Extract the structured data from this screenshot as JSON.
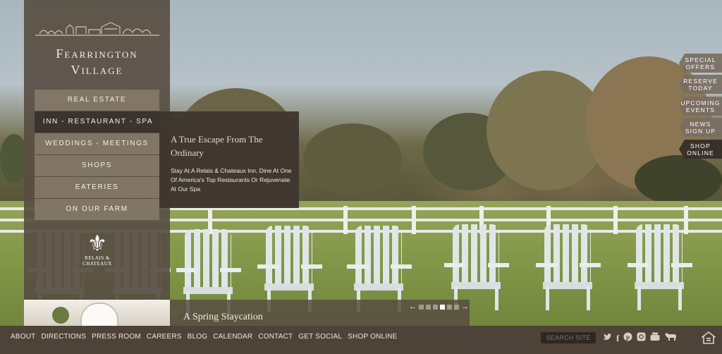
{
  "brand": {
    "title_line1": "Fearrington",
    "title_line2": "Village",
    "logo_icon": "farm-skyline-icon"
  },
  "nav": {
    "items": [
      {
        "label": "REAL ESTATE",
        "active": false
      },
      {
        "label": "INN - RESTAURANT - SPA",
        "active": true
      },
      {
        "label": "WEDDINGS - MEETINGS",
        "active": false
      },
      {
        "label": "SHOPS",
        "active": false
      },
      {
        "label": "EATERIES",
        "active": false
      },
      {
        "label": "ON OUR FARM",
        "active": false
      }
    ],
    "partner_logo_text_1": "RELAIS &",
    "partner_logo_text_2": "CHATEAUX",
    "partner_logo_icon": "fleur-de-lis-icon"
  },
  "flyout": {
    "title": "A True Escape From The Ordinary",
    "body": "Stay At A Relais & Chateaux Inn, Dine At One Of America's Top Restaurants Or Rejuvenate At Our Spa"
  },
  "side_tabs": [
    {
      "line1": "SPECIAL",
      "line2": "OFFERS"
    },
    {
      "line1": "RESERVE",
      "line2": "TODAY"
    },
    {
      "line1": "UPCOMING",
      "line2": "EVENTS"
    },
    {
      "line1": "NEWS",
      "line2": "SIGN UP"
    },
    {
      "line1": "SHOP",
      "line2": "ONLINE"
    }
  ],
  "slideshow": {
    "caption": "A Spring Staycation",
    "prev_icon": "arrow-left-icon",
    "next_icon": "arrow-right-icon",
    "slide_count": 6,
    "current_slide": 4
  },
  "footer": {
    "links": [
      "ABOUT",
      "DIRECTIONS",
      "PRESS ROOM",
      "CAREERS",
      "BLOG",
      "CALENDAR",
      "CONTACT",
      "GET SOCIAL",
      "SHOP ONLINE"
    ],
    "search_placeholder": "SEARCH SITE",
    "social_icons": [
      "twitter-icon",
      "facebook-icon",
      "pinterest-icon",
      "instagram-icon",
      "youtube-icon",
      "cow-icon"
    ],
    "home_icon": "equal-housing-icon"
  },
  "colors": {
    "panel": "#584e42",
    "panel_dark": "#3e3630",
    "footer": "#4e4338",
    "text_light": "#f2ece2"
  }
}
